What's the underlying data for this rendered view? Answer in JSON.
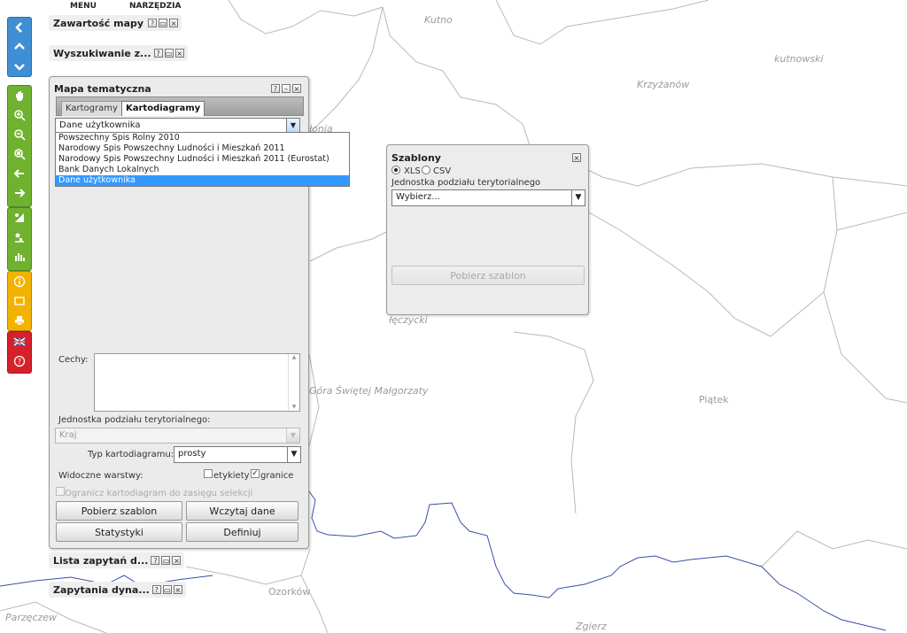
{
  "menu": {
    "menu_label": "MENU",
    "tools_label": "NARZĘDZIA"
  },
  "toolbar": {
    "nav": [
      "arrow-left-icon",
      "chevron-up-icon",
      "chevron-down-icon"
    ],
    "map_tools": [
      "pan-hand-icon",
      "zoom-in-icon",
      "zoom-out-icon",
      "zoom-extent-icon",
      "back-arrow-icon",
      "forward-arrow-icon"
    ],
    "analysis_tools": [
      "thematic-map-icon",
      "point-chart-icon",
      "bar-chart-icon"
    ],
    "info_tools": [
      "info-icon",
      "select-rectangle-icon",
      "print-icon"
    ],
    "misc_tools": [
      "english-flag-icon",
      "help-icon"
    ],
    "colors": {
      "blue": "#3f8fd4",
      "green": "#6fb22f",
      "yellow": "#f2b200",
      "red": "#d6212a"
    }
  },
  "collapsed_panels": {
    "map_contents": "Zawartość mapy",
    "search": "Wyszukiwanie z...",
    "query_list": "Lista zapytań d...",
    "dynamic_queries": "Zapytania dyna..."
  },
  "window_buttons": {
    "help": "?",
    "minimize": "–",
    "close": "×"
  },
  "thematic_panel": {
    "title": "Mapa tematyczna",
    "tabs": [
      "Kartogramy",
      "Kartodiagramy"
    ],
    "active_tab": "Kartodiagramy",
    "source_select": "Dane użytkownika",
    "source_options": [
      "Powszechny Spis Rolny 2010",
      "Narodowy Spis Powszechny Ludności i Mieszkań 2011",
      "Narodowy Spis Powszechny Ludności i Mieszkań 2011 (Eurostat)",
      "Bank Danych Lokalnych",
      "Dane użytkownika"
    ],
    "features_label": "Cechy:",
    "territorial_unit_label": "Jednostka podziału terytorialnego:",
    "territorial_unit_value": "Kraj",
    "diagram_type_label": "Typ kartodiagramu:",
    "diagram_type_value": "prosty",
    "visible_layers_label": "Widoczne warstwy:",
    "labels_checkbox": "etykiety",
    "boundaries_checkbox": "granice",
    "limit_checkbox": "Ogranicz kartodiagram do zasięgu selekcji",
    "buttons": {
      "download_template": "Pobierz szablon",
      "load_data": "Wczytaj dane",
      "statistics": "Statystyki",
      "define": "Definiuj"
    }
  },
  "templates_panel": {
    "title": "Szablony",
    "format_options": [
      "XLS",
      "CSV"
    ],
    "selected_format": "XLS",
    "unit_label": "Jednostka podziału terytorialnego",
    "unit_select": "Wybierz...",
    "download_button": "Pobierz szablon"
  },
  "map_labels": {
    "kutno": "Kutno",
    "kutnowski": "kutnowski",
    "krzyzanow": "Krzyżanów",
    "leczycki": "łęczycki",
    "gora": "Góra Świętej Małgorzaty",
    "piatek": "Piątek",
    "ozorkow": "Ozorków",
    "parzeczew": "Parzęczew",
    "zgierz": "Zgierz",
    "lonia_fragment": "łonia"
  }
}
